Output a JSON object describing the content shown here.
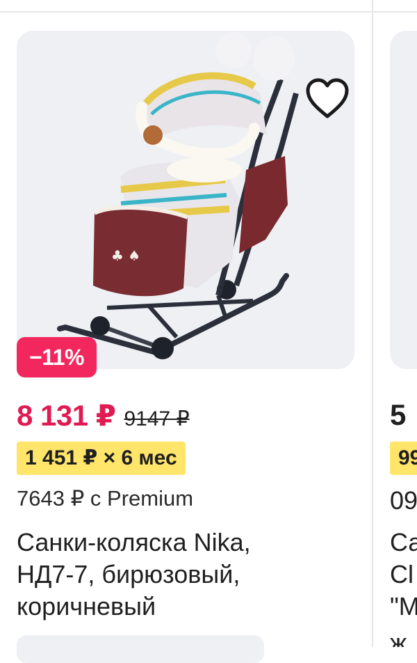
{
  "product": {
    "discount_badge": "−11%",
    "price": "8 131 ₽",
    "old_price": "9147 ₽",
    "installment": "1 451 ₽ × 6 мес",
    "premium_price": "7643 ₽ с Premium",
    "title_lines": [
      "Санки-коляска Nika,",
      "НД7-7, бирюзовый,",
      "коричневый"
    ],
    "favorite_icon": "heart-outline-icon",
    "image_alt": "Санки-коляска"
  },
  "next_product": {
    "price_partial": "5",
    "installment_partial": "99",
    "text_lines_partial": [
      "09",
      "Са",
      "Сl",
      "\"М",
      "ж"
    ]
  },
  "colors": {
    "price_accent": "#e01a52",
    "badge_bg": "#f2275e",
    "installment_bg": "#ffe56a",
    "image_bg": "#eef0f4"
  }
}
